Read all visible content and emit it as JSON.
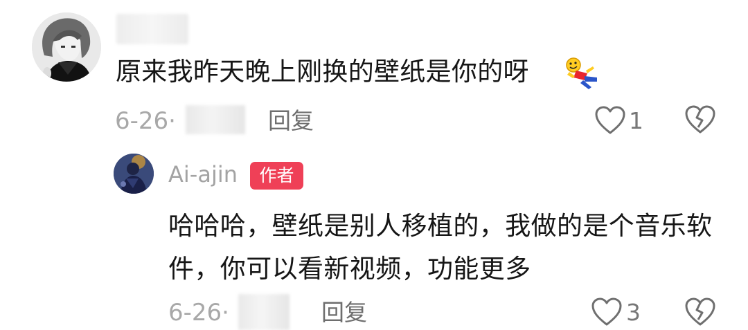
{
  "comment": {
    "avatar": "anime-character-avatar",
    "username_obscured": true,
    "text": "原来我昨天晚上刚换的壁纸是你的呀",
    "emoji": "falling-over-emoji",
    "date": "6-26·",
    "location_obscured": true,
    "reply_label": "回复",
    "like_count": "1",
    "like_icon": "heart-outline-icon",
    "dislike_icon": "broken-heart-icon"
  },
  "reply": {
    "avatar": "author-avatar",
    "author_name": "Ai-ajin",
    "author_badge": "作者",
    "text": "哈哈哈，壁纸是别人移植的，我做的是个音乐软件，你可以看新视频，功能更多",
    "date": "6-26·",
    "location_obscured": true,
    "reply_label": "回复",
    "like_count": "3",
    "like_icon": "heart-outline-icon",
    "dislike_icon": "broken-heart-icon"
  },
  "colors": {
    "badge": "#ef4057",
    "text_primary": "#161616",
    "text_secondary": "#a8a8a8",
    "reply_label": "#6e6e6e"
  }
}
